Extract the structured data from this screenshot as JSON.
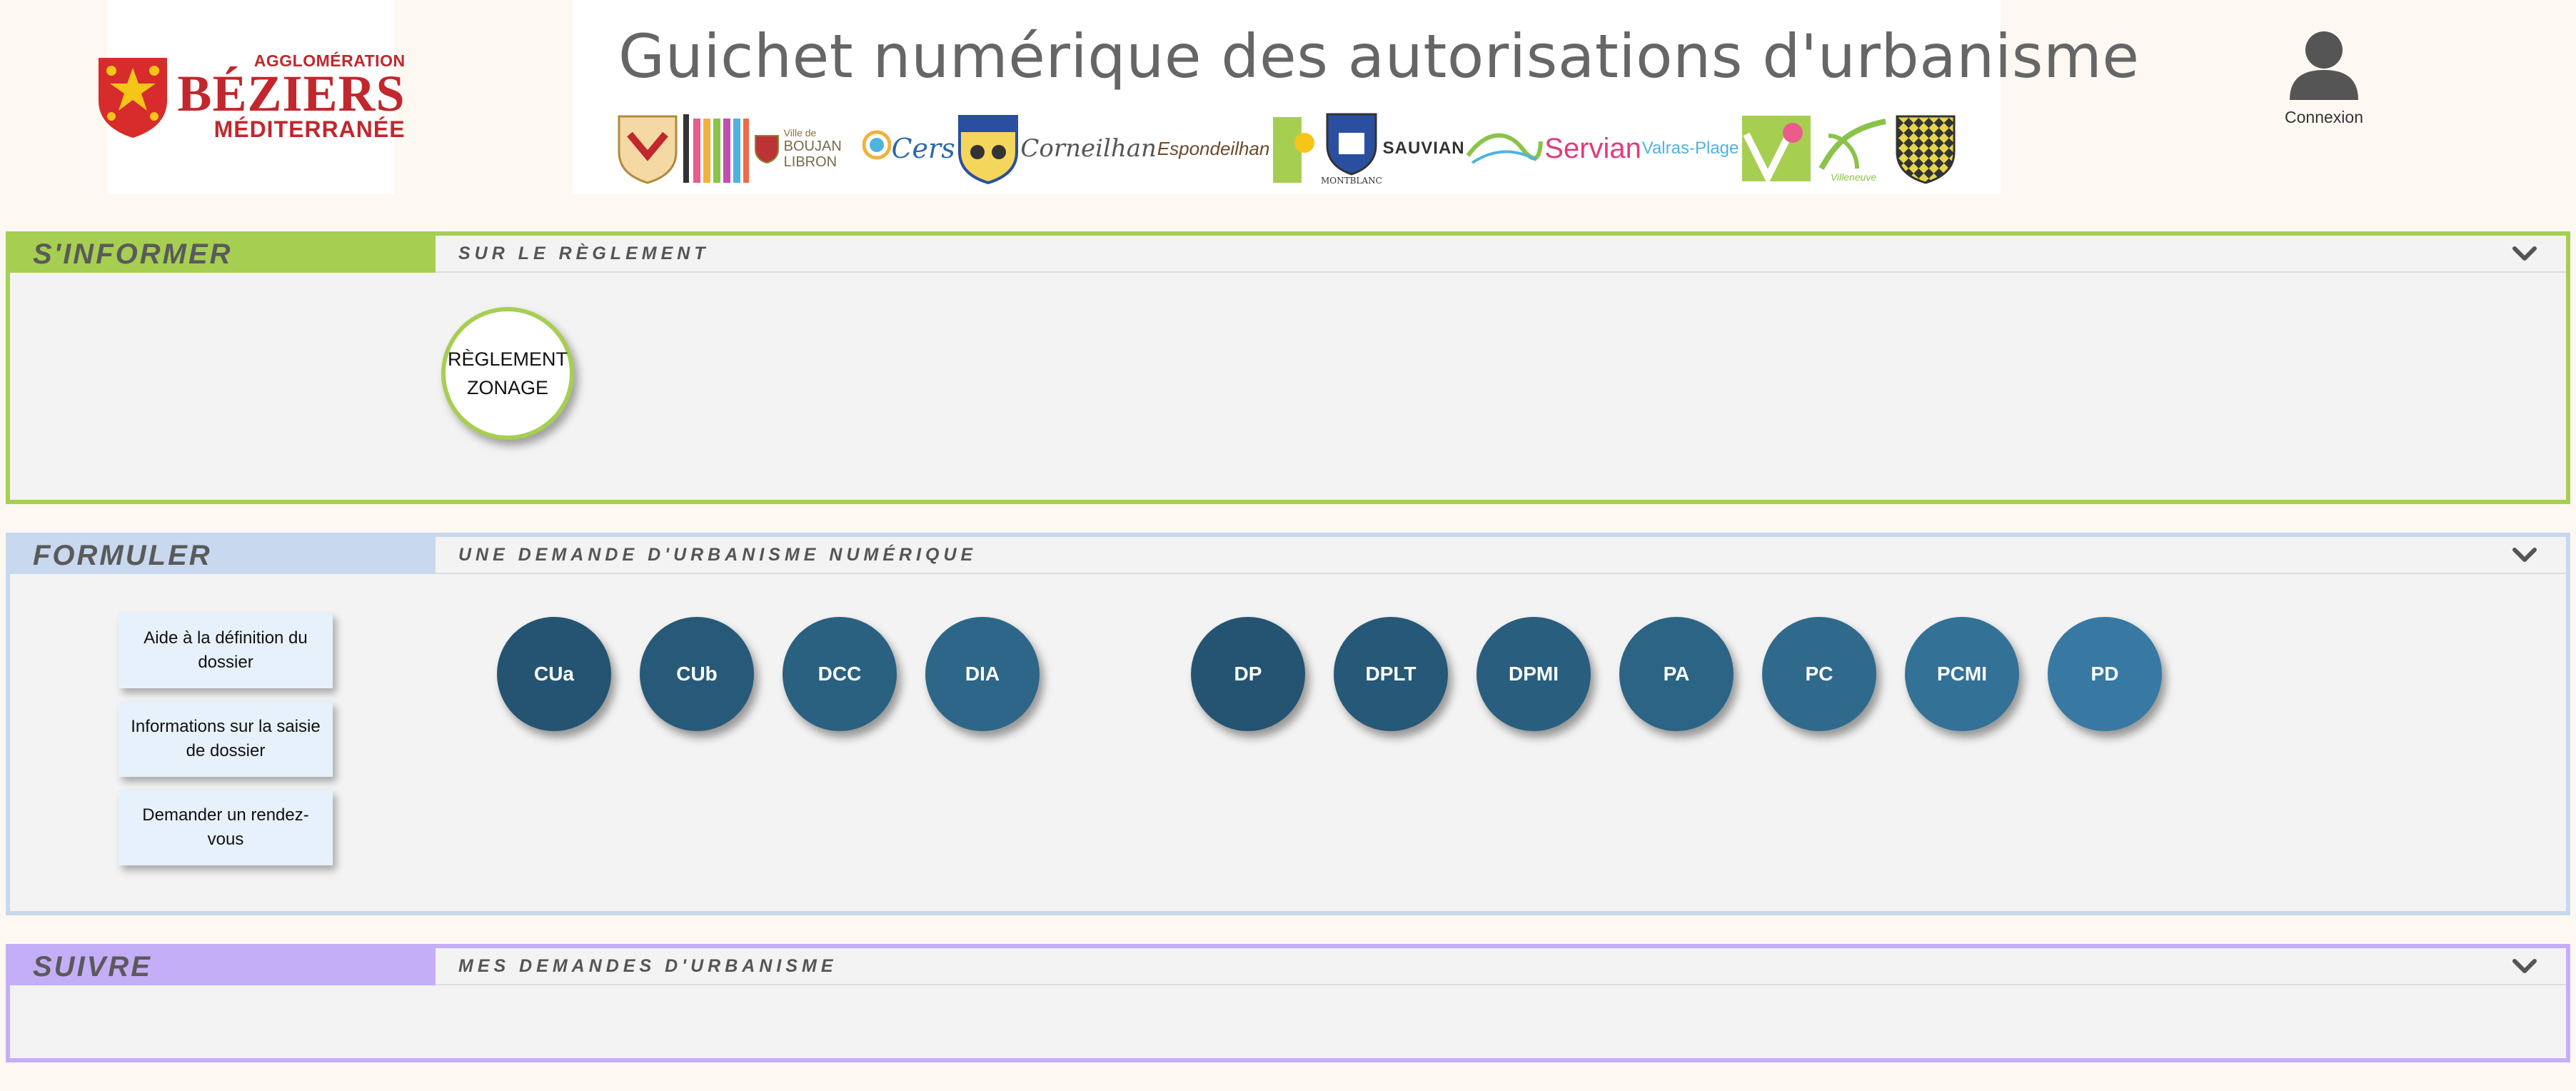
{
  "header": {
    "logo": {
      "line1": "AGGLOMÉRATION",
      "line2": "BÉZIERS",
      "line3": "MÉDITERRANÉE"
    },
    "banner_title": "Guichet numérique des autorisations d'urbanisme",
    "crests": {
      "boujan_small": "Ville de",
      "boujan": "BOUJAN LIBRON",
      "cers": "Cers",
      "corneilhan": "Corneilhan",
      "espondeilhan": "Espondeilhan",
      "montblanc": "MONTBLANC",
      "sauvian": "SAUVIAN",
      "servian": "Servian",
      "valras": "Valras-Plage",
      "villeneuve": "Villeneuve"
    },
    "user_label": "Connexion"
  },
  "sections": {
    "informer": {
      "title": "S'INFORMER",
      "subtitle": "SUR LE RÈGLEMENT",
      "reglement_line1": "RÈGLEMENT",
      "reglement_line2": "ZONAGE"
    },
    "formuler": {
      "title": "FORMULER",
      "subtitle": "UNE DEMANDE D'URBANISME NUMÉRIQUE",
      "side_buttons": [
        "Aide à la définition du dossier",
        "Informations sur la saisie de dossier",
        "Demander un rendez-vous"
      ],
      "group1": [
        "CUa",
        "CUb",
        "DCC",
        "DIA"
      ],
      "group2": [
        "DP",
        "DPLT",
        "DPMI",
        "PA",
        "PC",
        "PCMI",
        "PD"
      ]
    },
    "suivre": {
      "title": "SUIVRE",
      "subtitle": "MES DEMANDES D'URBANISME"
    }
  },
  "colors": {
    "informer": "#a6cf52",
    "formuler": "#c7d8ef",
    "suivre": "#c5aef8",
    "circle_dark": "#245471",
    "circle_light": "#3779a2"
  },
  "icons": [
    "user-icon",
    "chevron-down-icon",
    "occitan-cross-icon"
  ]
}
